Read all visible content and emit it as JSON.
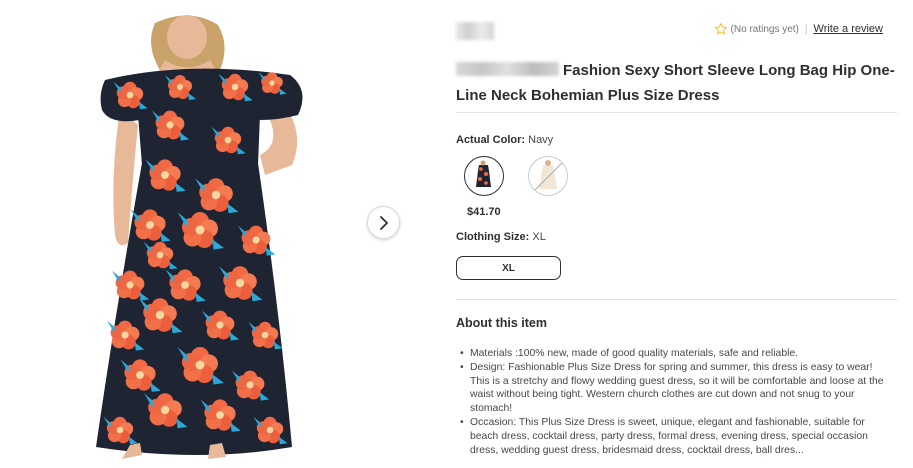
{
  "product": {
    "title_text": "Fashion Sexy Short Sleeve Long Bag Hip One-Line Neck Bohemian Plus Size Dress",
    "image_alt": "Woman wearing navy off-shoulder floral maxi dress"
  },
  "rating": {
    "status": "(No ratings yet)",
    "separator": "|",
    "write_review": "Write a review"
  },
  "color": {
    "label": "Actual Color:",
    "value": "Navy",
    "price": "$41.70"
  },
  "size": {
    "label": "Clothing Size:",
    "value": "XL",
    "selected_option": "XL"
  },
  "about": {
    "heading": "About this item",
    "bullets": [
      "Materials :100% new, made of good quality materials, safe and reliable.",
      "Design: Fashionable Plus Size Dress for spring and summer, this dress is easy to wear! This is a stretchy and flowy wedding guest dress, so it will be comfortable and loose at the waist without being tight. Western church clothes are cut down and not snug to your stomach!",
      "Occasion: This Plus Size Dress is sweet, unique, elegant and fashionable, suitable for beach dress, cocktail dress, party dress, formal dress, evening dress, special occasion dress, wedding guest dress, bridesmaid dress, cocktail dress, ball dres..."
    ]
  },
  "icons": {
    "star": "star-outline-icon",
    "next": "chevron-right-icon"
  },
  "colors": {
    "text": "#2e2f32",
    "muted": "#74767c",
    "star": "#ffc220",
    "dress_navy": "#1f2433",
    "flower": "#f06a45"
  }
}
